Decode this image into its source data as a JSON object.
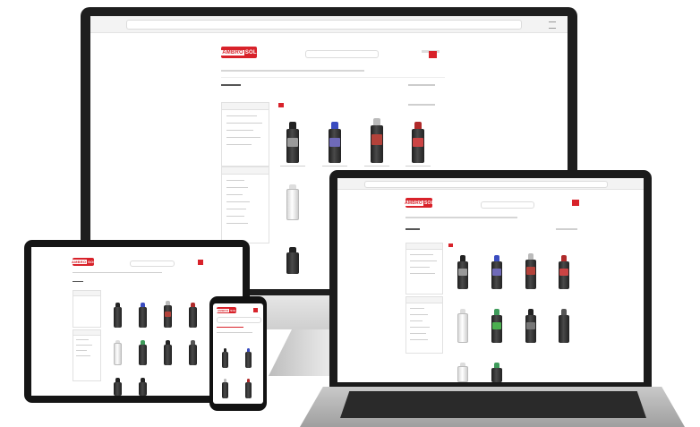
{
  "brand": {
    "logo_text": "AMBRO",
    "logo_accent": "SOL",
    "primary_color": "#d8222a",
    "secondary_color": "#3a70b8"
  },
  "devices": [
    {
      "name": "desktop-monitor"
    },
    {
      "name": "laptop"
    },
    {
      "name": "tablet"
    },
    {
      "name": "smartphone"
    }
  ],
  "icons": {
    "cart": "shopping-cart-icon",
    "search": "search-icon",
    "grid_view": "grid-view-icon",
    "list_view": "list-view-icon"
  }
}
